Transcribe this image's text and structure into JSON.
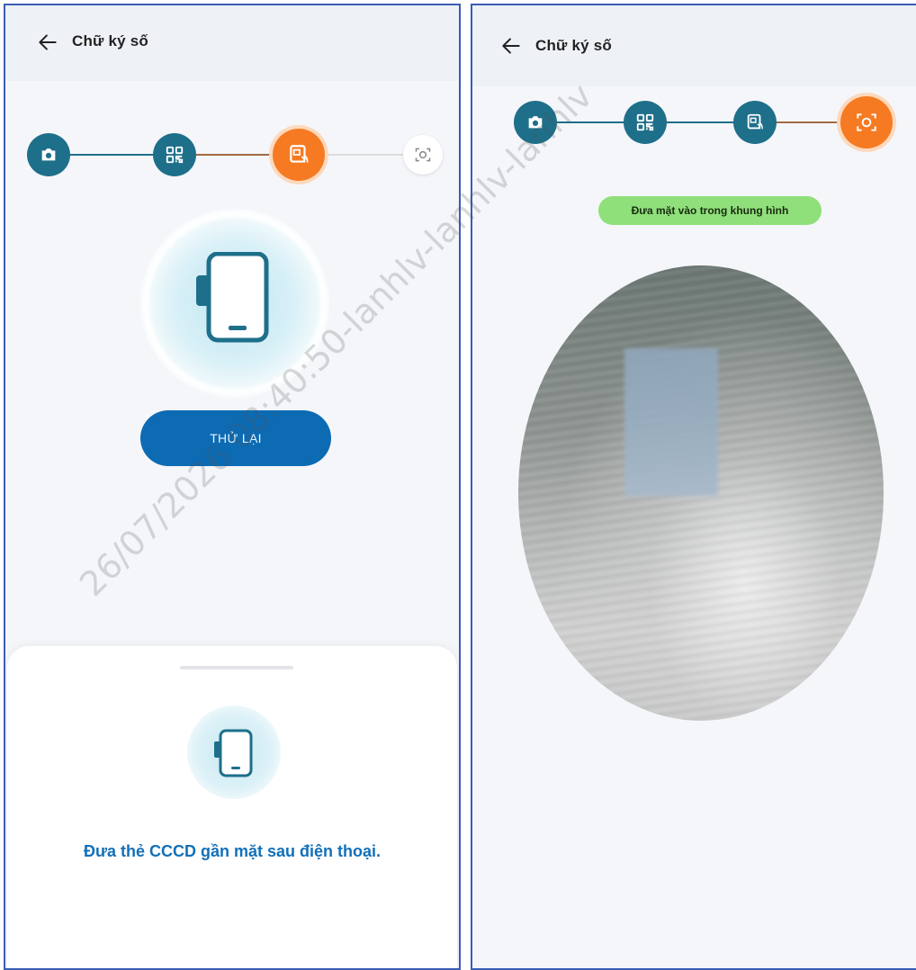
{
  "left_screen": {
    "header": {
      "title": "Chữ ký số"
    },
    "stepper": {
      "steps": [
        {
          "icon": "camera-icon",
          "state": "done"
        },
        {
          "icon": "qr-code-icon",
          "state": "done"
        },
        {
          "icon": "nfc-card-icon",
          "state": "active"
        },
        {
          "icon": "face-scan-icon",
          "state": "pending"
        }
      ]
    },
    "retry_button": {
      "label": "THỬ LẠI"
    },
    "bottom_sheet": {
      "message": "Đưa thẻ CCCD gần mặt sau điện thoại."
    }
  },
  "right_screen": {
    "header": {
      "title": "Chữ ký số"
    },
    "stepper": {
      "steps": [
        {
          "icon": "camera-icon",
          "state": "done"
        },
        {
          "icon": "qr-code-icon",
          "state": "done"
        },
        {
          "icon": "nfc-card-icon",
          "state": "done"
        },
        {
          "icon": "face-scan-icon",
          "state": "active"
        }
      ]
    },
    "face_hint": "Đưa mặt vào trong khung hình"
  },
  "watermark": "26/07/2026 08:40:50-lanhlv-lanhlv-lanhlv",
  "colors": {
    "primary": "#1e6f8a",
    "accent": "#f57a22",
    "button": "#0d6bb4",
    "hint_bg": "#8fe07a",
    "message_text": "#1270b8"
  }
}
